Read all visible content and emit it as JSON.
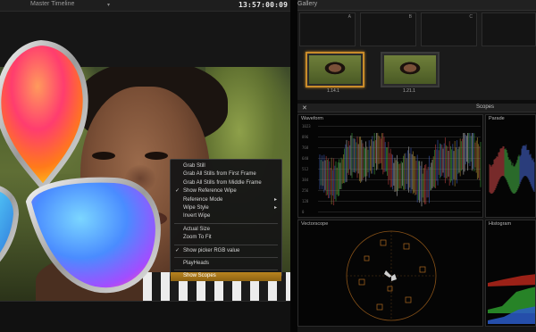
{
  "viewer": {
    "timeline_name": "Master Timeline",
    "dropdown_icon": "chevron-down-icon",
    "timecode": "13:57:00:09"
  },
  "context_menu": {
    "items": [
      {
        "label": "Grab Still",
        "checked": false,
        "submenu": false
      },
      {
        "label": "Grab All Stills from First Frame",
        "checked": false,
        "submenu": false
      },
      {
        "label": "Grab All Stills from Middle Frame",
        "checked": false,
        "submenu": false
      },
      {
        "label": "Show Reference Wipe",
        "checked": true,
        "submenu": false
      },
      {
        "label": "Reference Mode",
        "checked": false,
        "submenu": true
      },
      {
        "label": "Wipe Style",
        "checked": false,
        "submenu": true
      },
      {
        "label": "Invert Wipe",
        "checked": false,
        "submenu": false
      },
      {
        "label": "Actual Size",
        "checked": false,
        "submenu": false
      },
      {
        "label": "Zoom To Fit",
        "checked": false,
        "submenu": false
      },
      {
        "label": "Show picker RGB value",
        "checked": true,
        "submenu": false
      },
      {
        "label": "PlayHeads",
        "checked": false,
        "submenu": false
      },
      {
        "label": "Show Scopes",
        "checked": false,
        "submenu": false,
        "highlighted": true
      }
    ],
    "check_glyph": "✓",
    "submenu_glyph": "▸"
  },
  "gallery": {
    "title": "Gallery",
    "memory_slots": [
      "A",
      "B",
      "C"
    ],
    "stills": [
      {
        "label": "1.14.1",
        "selected": true
      },
      {
        "label": "1.21.1",
        "selected": false
      }
    ]
  },
  "scopes": {
    "title": "Scopes",
    "close_glyph": "✕",
    "waveform": {
      "title": "Waveform",
      "ticks": [
        "1023",
        "896",
        "768",
        "640",
        "512",
        "384",
        "256",
        "128",
        "0"
      ]
    },
    "parade": {
      "title": "Parade"
    },
    "vectorscope": {
      "title": "Vectorscope"
    },
    "histogram": {
      "title": "Histogram"
    }
  },
  "colors": {
    "highlight": "#b8831f",
    "selected_still_border": "#c98c2a",
    "vectorscope_targets": "#b06a1e"
  }
}
